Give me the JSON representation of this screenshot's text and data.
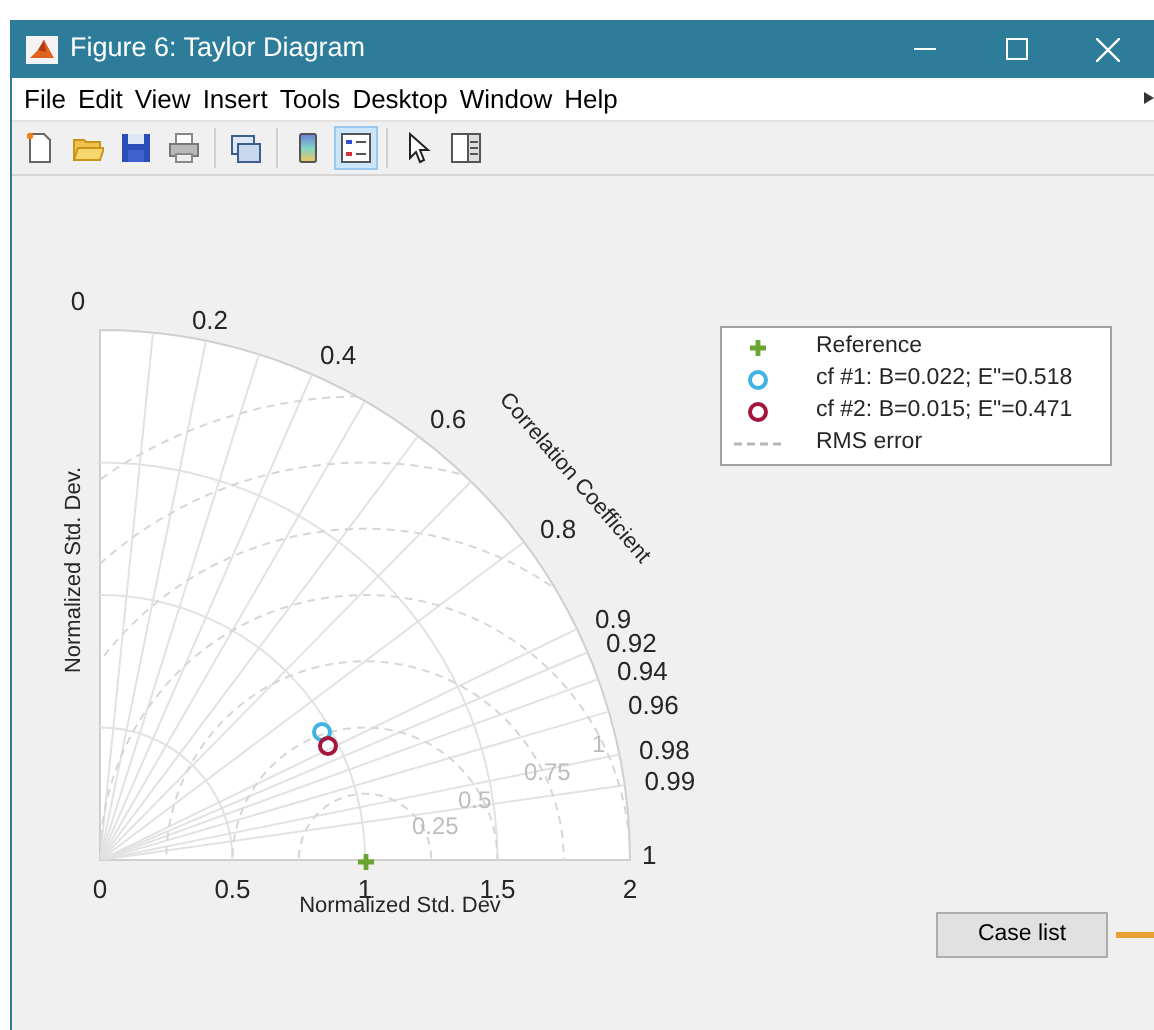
{
  "window": {
    "title": "Figure 6: Taylor Diagram"
  },
  "menu": [
    "File",
    "Edit",
    "View",
    "Insert",
    "Tools",
    "Desktop",
    "Window",
    "Help"
  ],
  "toolbar": [
    {
      "kind": "new",
      "selected": false
    },
    {
      "kind": "open",
      "selected": false
    },
    {
      "kind": "save",
      "selected": false
    },
    {
      "kind": "print",
      "selected": false
    },
    {
      "kind": "link",
      "selected": false
    },
    {
      "kind": "colorbar",
      "selected": false
    },
    {
      "kind": "legend",
      "selected": true
    },
    {
      "kind": "pointer",
      "selected": false
    },
    {
      "kind": "panel",
      "selected": false
    }
  ],
  "diagram": {
    "correlation_ticks": [
      "0",
      "0.2",
      "0.4",
      "0.6",
      "0.8",
      "0.9",
      "0.92",
      "0.94",
      "0.96",
      "0.98",
      "0.99",
      "1"
    ],
    "std_ticks": [
      "0",
      "0.5",
      "1",
      "1.5",
      "2"
    ],
    "rms_ticks": [
      "0.25",
      "0.5",
      "0.75",
      "1"
    ],
    "xlabel": "Normalized Std. Dev",
    "ylabel": "Normalized Std. Dev.",
    "arc_label": "Correlation Coefficient",
    "points": [
      {
        "kind": "plus",
        "color": "#6aa533"
      },
      {
        "kind": "circle",
        "color": "#3fb3e3"
      },
      {
        "kind": "circle",
        "color": "#a3173d"
      }
    ]
  },
  "legend": [
    {
      "kind": "plus",
      "color": "#6aa533",
      "label": "Reference"
    },
    {
      "kind": "circle",
      "color": "#3fb3e3",
      "label": "cf #1: B=0.022; E\"=0.518"
    },
    {
      "kind": "circle",
      "color": "#a3173d",
      "label": "cf #2: B=0.015; E\"=0.471"
    },
    {
      "kind": "dashed",
      "color": "#b8b8b8",
      "label": "RMS error"
    }
  ],
  "button": "Case list"
}
